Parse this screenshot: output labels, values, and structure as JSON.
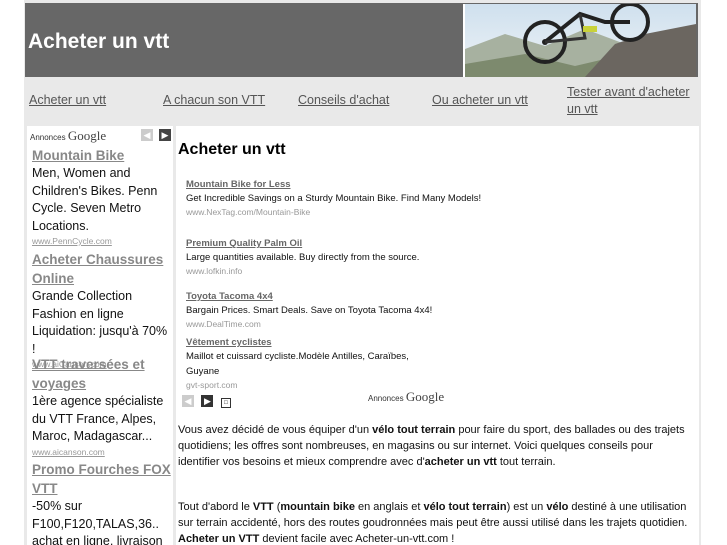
{
  "header": {
    "site_title": "Acheter un vtt",
    "banner_alt": "mountain-bike-photo"
  },
  "nav": {
    "items": [
      {
        "label": "Acheter un vtt"
      },
      {
        "label": "A chacun son VTT"
      },
      {
        "label": "Conseils d'achat"
      },
      {
        "label": "Ou acheter un vtt"
      },
      {
        "label": "Tester avant d'acheter un vtt"
      }
    ]
  },
  "sidebar": {
    "annonces_label": "Annonces",
    "google_label": "Google",
    "ads": [
      {
        "title": "Mountain Bike",
        "desc": "Men, Women and Children's Bikes. Penn Cycle. Seven Metro Locations.",
        "url": "www.PennCycle.com"
      },
      {
        "title": "Acheter Chaussures Online",
        "desc": "Grande Collection Fashion en ligne Liquidation: jusqu'à 70% !",
        "url": "www.aiCanson.com"
      },
      {
        "title": "VTT traversées et voyages",
        "desc": "1ère agence spécialiste du VTT France, Alpes, Maroc, Madagascar...",
        "url": "www.aicanson.com"
      },
      {
        "title": "Promo Fourches FOX VTT",
        "desc": "-50% sur F100,F120,TALAS,36.. achat en ligne, livraison",
        "url": ""
      }
    ]
  },
  "main": {
    "title": "Acheter un vtt",
    "ads": [
      {
        "title": "Mountain Bike for Less",
        "desc": "Get Incredible Savings on a Sturdy Mountain Bike. Find Many Models!",
        "url": "www.NexTag.com/Mountain-Bike"
      },
      {
        "title": "Premium Quality Palm Oil",
        "desc": "Large quantities available. Buy directly from the source.",
        "url": "www.lofkin.info"
      },
      {
        "title": "Toyota Tacoma 4x4",
        "desc": "Bargain Prices. Smart Deals. Save on Toyota Tacoma 4x4!",
        "url": "www.DealTime.com"
      },
      {
        "title": "Vêtement cyclistes",
        "desc": "Maillot et cuissard cycliste.Modèle Antilles, Caraïbes, Guyane",
        "url": "gvt-sport.com"
      }
    ],
    "ad_footer_annonces": "Annonces",
    "ad_footer_google": "Google",
    "para1": {
      "t1": "Vous avez décidé de vous équiper d'un ",
      "b1": "vélo tout terrain",
      "t2": " pour faire du sport, des ballades ou des trajets quotidiens; les offres sont nombreuses, en magasins ou sur internet. Voici quelques conseils pour identifier vos besoins et mieux comprendre avec d'",
      "b2": "acheter un vtt",
      "t3": " tout terrain."
    },
    "para2": {
      "t1": "Tout d'abord le ",
      "b1": "VTT",
      "t2": " (",
      "b2": "mountain bike",
      "t3": " en anglais et ",
      "b3": "vélo tout terrain",
      "t4": ") est un ",
      "b4": "vélo",
      "t5": " destiné à une utilisation sur terrain accidenté, hors des routes goudronnées mais peut être aussi utilisé dans les trajets quotidien. ",
      "b5": "Acheter un VTT",
      "t6": " devient facile avec Acheter-un-vtt.com !"
    }
  },
  "colors": {
    "header_bg": "#676767",
    "page_bg": "#e9e9e9",
    "link": "#555555"
  }
}
